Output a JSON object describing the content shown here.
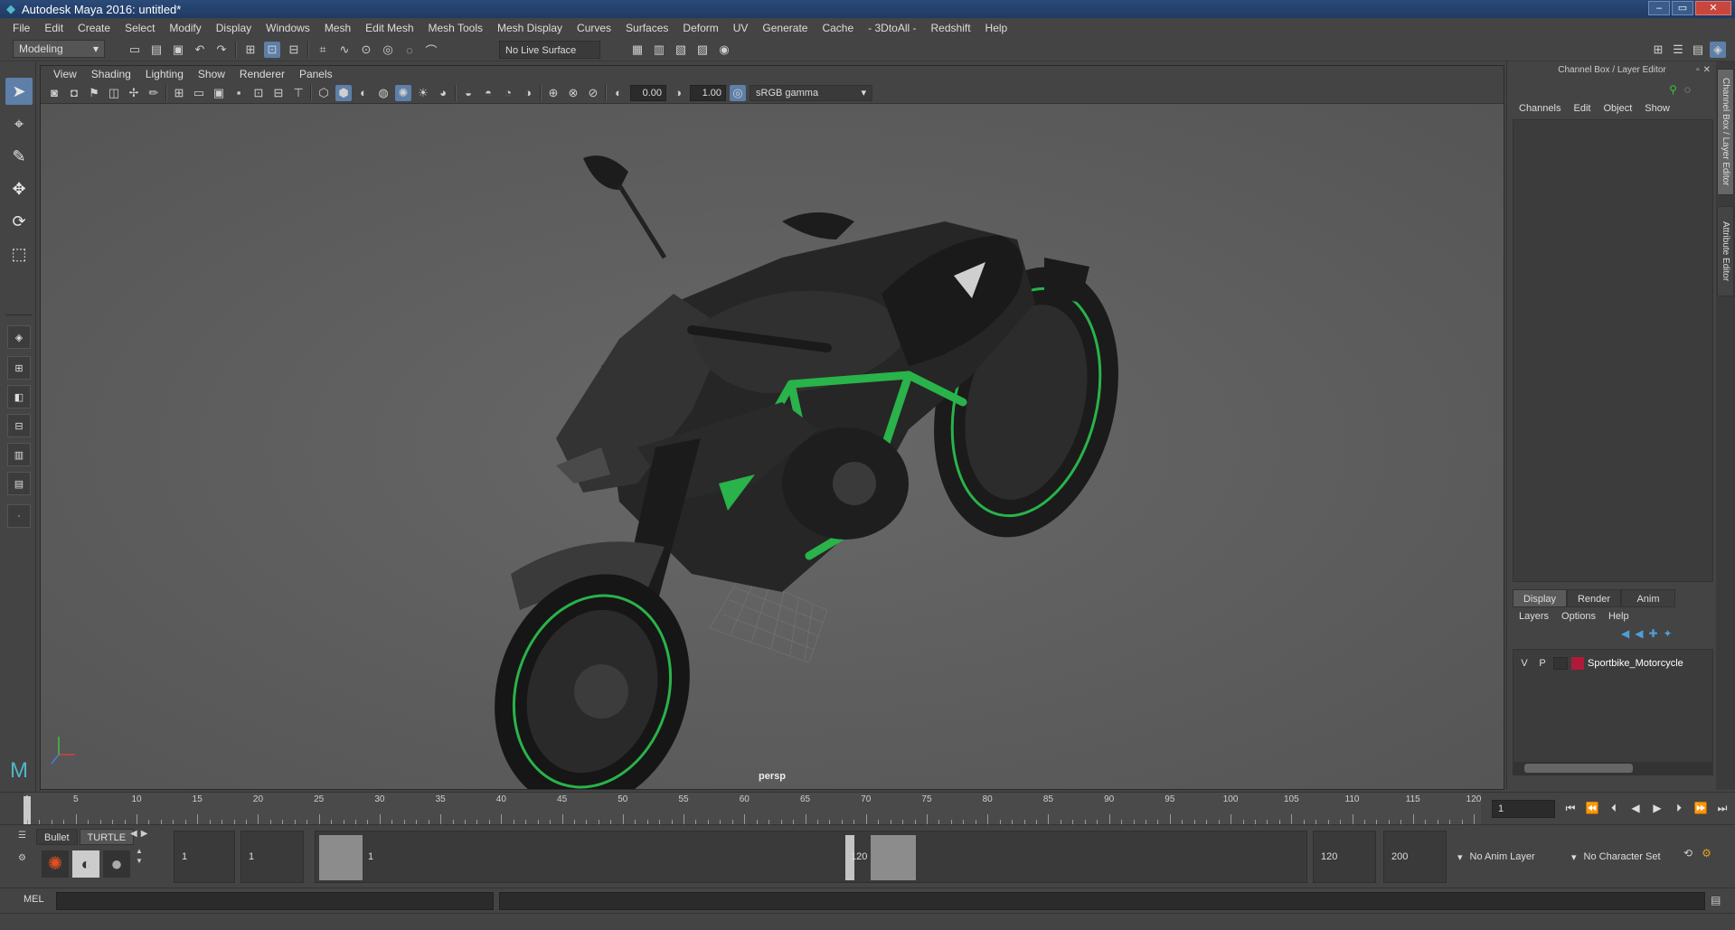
{
  "title_bar": {
    "title": "Autodesk Maya 2016: untitled*",
    "controls": [
      "–",
      "▭",
      "✕"
    ]
  },
  "menu": [
    "File",
    "Edit",
    "Create",
    "Select",
    "Modify",
    "Display",
    "Windows",
    "Mesh",
    "Edit Mesh",
    "Mesh Tools",
    "Mesh Display",
    "Curves",
    "Surfaces",
    "Deform",
    "UV",
    "Generate",
    "Cache",
    "- 3DtoAll -",
    "Redshift",
    "Help"
  ],
  "status_line": {
    "mode": "Modeling",
    "live_surface": "No Live Surface"
  },
  "viewport": {
    "menu": [
      "View",
      "Shading",
      "Lighting",
      "Show",
      "Renderer",
      "Panels"
    ],
    "exposure": "0.00",
    "gamma": "1.00",
    "color_space": "sRGB gamma",
    "camera_label": "persp"
  },
  "channel_box": {
    "header": "Channel Box / Layer Editor",
    "menu": [
      "Channels",
      "Edit",
      "Object",
      "Show"
    ]
  },
  "layer_editor": {
    "tabs": [
      "Display",
      "Render",
      "Anim"
    ],
    "active_tab": "Display",
    "menu": [
      "Layers",
      "Options",
      "Help"
    ],
    "layers": [
      {
        "v": "V",
        "p": "P",
        "name": "Sportbike_Motorcycle",
        "color": "#b01a3a"
      }
    ]
  },
  "side_tabs": [
    "Channel Box / Layer Editor",
    "Attribute Editor"
  ],
  "timeline": {
    "ticks": [
      "1",
      "5",
      "10",
      "15",
      "20",
      "25",
      "30",
      "35",
      "40",
      "45",
      "50",
      "55",
      "60",
      "65",
      "70",
      "75",
      "80",
      "85",
      "90",
      "95",
      "100",
      "105",
      "110",
      "115",
      "120"
    ],
    "current_frame": "1"
  },
  "shelf": {
    "tabs": [
      "Bullet",
      "TURTLE"
    ]
  },
  "range": {
    "start": "1",
    "playback_start": "1",
    "slider_start": "1",
    "slider_end": "120",
    "playback_end": "120",
    "end": "200",
    "anim_layer": "No Anim Layer",
    "character_set": "No Character Set"
  },
  "command_line": {
    "lang": "MEL"
  },
  "colors": {
    "accent": "#5d7fa8",
    "titlebar": "#1f3a63",
    "bike_green": "#29b34a",
    "layer_color": "#b01a3a"
  }
}
